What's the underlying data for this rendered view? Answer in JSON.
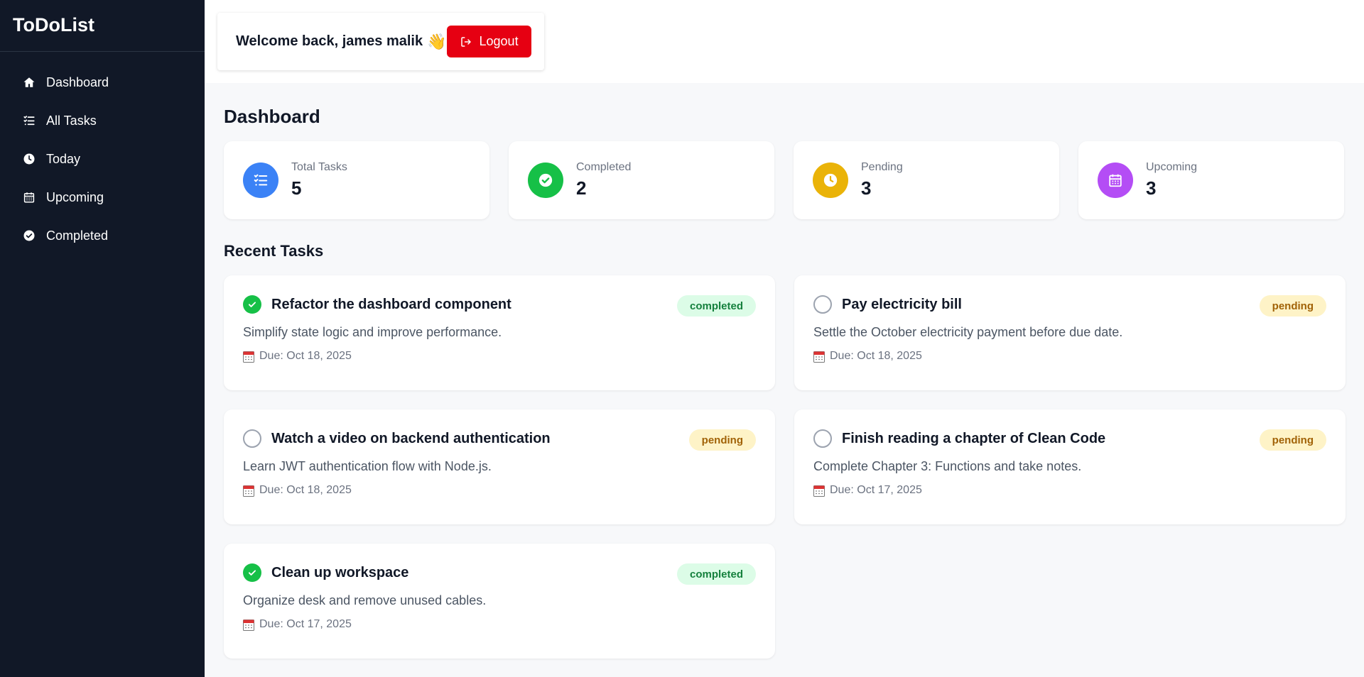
{
  "app": {
    "brand": "ToDoList"
  },
  "sidebar": {
    "items": [
      {
        "label": "Dashboard",
        "icon": "home-icon"
      },
      {
        "label": "All Tasks",
        "icon": "list-check-icon"
      },
      {
        "label": "Today",
        "icon": "clock-icon"
      },
      {
        "label": "Upcoming",
        "icon": "calendar-icon"
      },
      {
        "label": "Completed",
        "icon": "check-circle-icon"
      }
    ]
  },
  "header": {
    "welcome": "Welcome back, james malik",
    "wave_emoji": "👋",
    "logout_label": "Logout"
  },
  "main": {
    "title": "Dashboard",
    "stats": [
      {
        "label": "Total Tasks",
        "value": "5",
        "color": "#3b82f6",
        "icon": "list-check-icon"
      },
      {
        "label": "Completed",
        "value": "2",
        "color": "#16c047",
        "icon": "check-circle-icon"
      },
      {
        "label": "Pending",
        "value": "3",
        "color": "#eab308",
        "icon": "clock-icon"
      },
      {
        "label": "Upcoming",
        "value": "3",
        "color": "#b44df5",
        "icon": "calendar-icon"
      }
    ],
    "recent_title": "Recent Tasks",
    "tasks": [
      {
        "title": "Refactor the dashboard component",
        "status": "completed",
        "description": "Simplify state logic and improve performance.",
        "due": "Due: Oct 18, 2025"
      },
      {
        "title": "Pay electricity bill",
        "status": "pending",
        "description": "Settle the October electricity payment before due date.",
        "due": "Due: Oct 18, 2025"
      },
      {
        "title": "Watch a video on backend authentication",
        "status": "pending",
        "description": "Learn JWT authentication flow with Node.js.",
        "due": "Due: Oct 18, 2025"
      },
      {
        "title": "Finish reading a chapter of Clean Code",
        "status": "pending",
        "description": "Complete Chapter 3: Functions and take notes.",
        "due": "Due: Oct 17, 2025"
      },
      {
        "title": "Clean up workspace",
        "status": "completed",
        "description": "Organize desk and remove unused cables.",
        "due": "Due: Oct 17, 2025"
      }
    ]
  },
  "colors": {
    "sidebar_bg": "#111827",
    "logout_bg": "#e60012",
    "completed_badge_bg": "#dcfce7",
    "pending_badge_bg": "#fef3c7"
  }
}
